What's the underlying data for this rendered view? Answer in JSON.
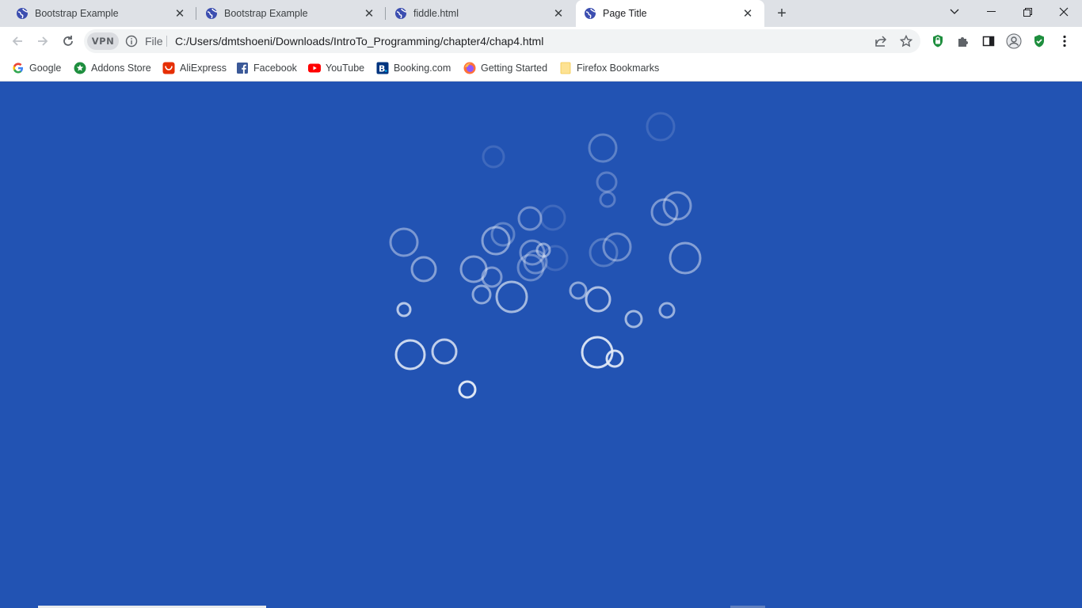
{
  "tabs": [
    {
      "title": "Bootstrap Example",
      "active": false
    },
    {
      "title": "Bootstrap Example",
      "active": false
    },
    {
      "title": "fiddle.html",
      "active": false
    },
    {
      "title": "Page Title",
      "active": true
    }
  ],
  "toolbar": {
    "vpn_label": "VPN",
    "scheme": "File",
    "url": "C:/Users/dmtshoeni/Downloads/IntroTo_Programming/chapter4/chap4.html"
  },
  "bookmarks": [
    {
      "label": "Google",
      "icon": "google-icon"
    },
    {
      "label": "Addons Store",
      "icon": "addons-store-icon"
    },
    {
      "label": "AliExpress",
      "icon": "aliexpress-icon"
    },
    {
      "label": "Facebook",
      "icon": "facebook-icon"
    },
    {
      "label": "YouTube",
      "icon": "youtube-icon"
    },
    {
      "label": "Booking.com",
      "icon": "booking-icon"
    },
    {
      "label": "Getting Started",
      "icon": "firefox-icon"
    },
    {
      "label": "Firefox Bookmarks",
      "icon": "folder-icon"
    }
  ],
  "colors": {
    "page_background": "#2253b3",
    "bubble_stroke": "#e8eef8"
  }
}
